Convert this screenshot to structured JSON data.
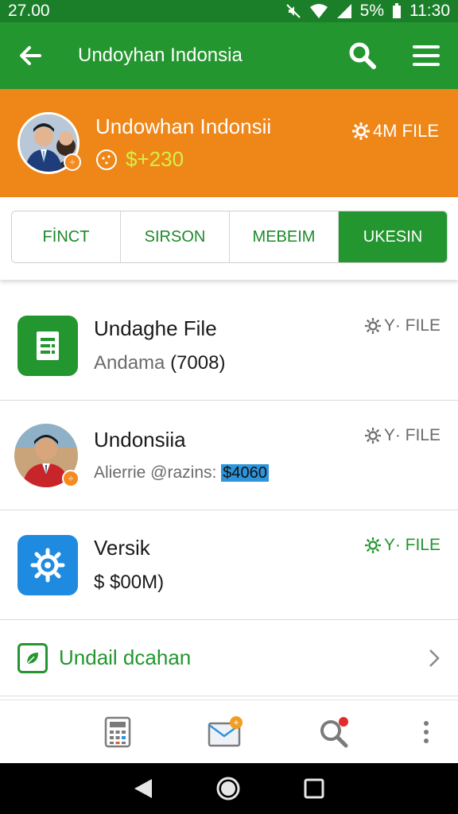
{
  "status_bar": {
    "time_left": "27.00",
    "battery": "5%",
    "time_right": "11:30"
  },
  "app_bar": {
    "title": "Undoyhan Indonsia",
    "icons": [
      "back-arrow-icon",
      "search-icon",
      "menu-icon"
    ]
  },
  "profile": {
    "name": "Undowhan Indonsii",
    "balance": "$+230",
    "file_label": "4M FILE"
  },
  "tabs": [
    {
      "label": "FİNCT",
      "active": false
    },
    {
      "label": "SIRSON",
      "active": false
    },
    {
      "label": "MEBEIM",
      "active": false
    },
    {
      "label": "UKESIN",
      "active": true
    }
  ],
  "items": [
    {
      "title": "Undaghe File",
      "subtitle_prefix": "Andama",
      "subtitle_value": "(7008)",
      "meta": "Y· FILE",
      "icon": "document-icon"
    },
    {
      "title": "Undonsiia",
      "subtitle_prefix": "Alierrie @razins:",
      "subtitle_value": "$4060",
      "meta": "Y· FILE",
      "icon": "avatar"
    },
    {
      "title": "Versik",
      "subtitle_prefix": "$",
      "subtitle_value": "$00M)",
      "meta": "Y· FILE",
      "icon": "gear-icon"
    }
  ],
  "link_row": {
    "label": "Undail dcahan",
    "icon": "leaf-icon"
  },
  "bottom_nav": {
    "icons": [
      "calculator-icon",
      "mail-icon",
      "search-icon",
      "more-vertical-icon"
    ]
  },
  "colors": {
    "primary_green": "#23962f",
    "orange": "#ee8618",
    "balance_yellow": "#d4f046",
    "highlight_blue": "#2d95dc"
  }
}
